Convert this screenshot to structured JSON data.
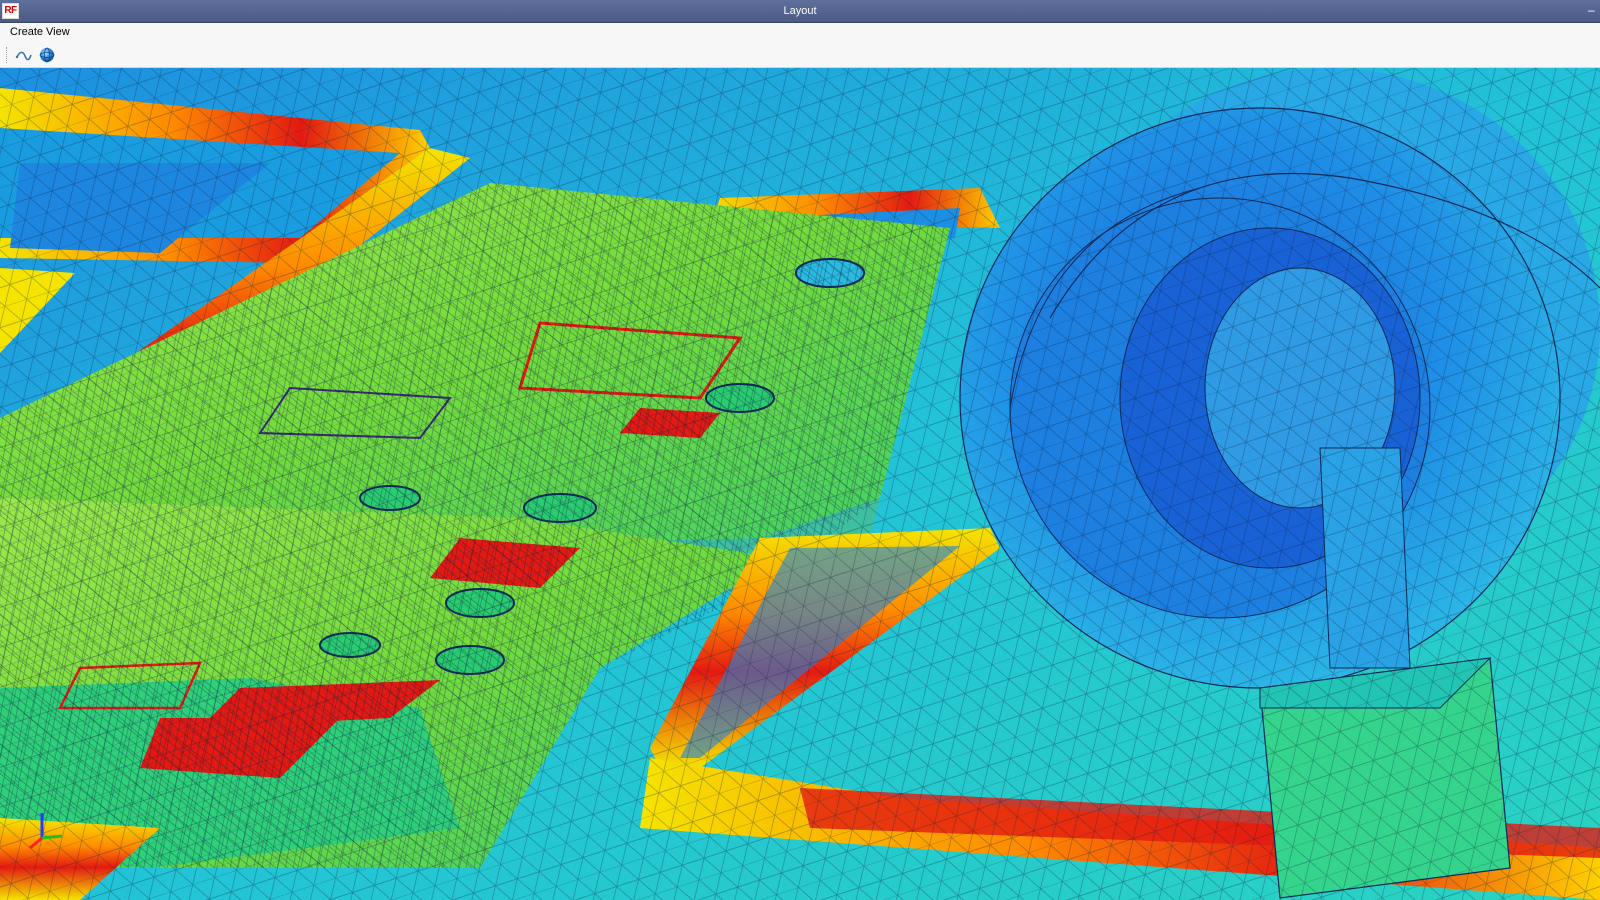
{
  "window": {
    "title": "Layout",
    "logo_text": "RF",
    "minimize_glyph": "–"
  },
  "menu": {
    "items": [
      "Create",
      "View"
    ]
  },
  "toolbar": {
    "tools": [
      "curve-tool-icon",
      "sphere-tool-icon"
    ]
  },
  "viewport": {
    "content": "3D mesh field plot",
    "colors": {
      "low": "#1166e0",
      "mid": "#22d3c8",
      "field_green": "#7fe040",
      "yellow": "#f5e400",
      "orange": "#ff8a00",
      "high": "#e31a12"
    }
  }
}
